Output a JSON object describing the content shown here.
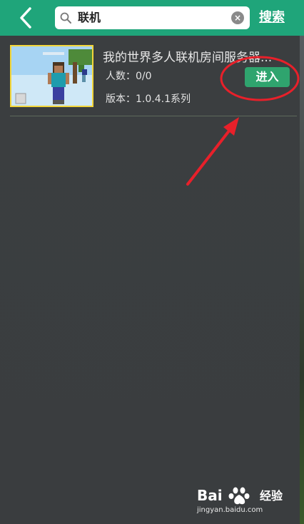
{
  "search": {
    "query": "联机",
    "button_label": "搜索",
    "clear_glyph": "×"
  },
  "result": {
    "title": "我的世界多人联机房间服务器...",
    "players_label": "人数：0/0",
    "version_label": "版本：1.0.4.1系列",
    "enter_label": "进入"
  },
  "watermark": {
    "brand": "Bai",
    "brand_suffix": "经验",
    "url": "jingyan.baidu.com"
  },
  "colors": {
    "header": "#1fa57a",
    "background": "#3c3f41",
    "enter_button": "#2fa46e",
    "annotation": "#e8202a",
    "thumb_border": "#f2d63a"
  },
  "icons": {
    "back": "chevron-left-icon",
    "search": "magnifier-icon",
    "clear": "clear-circle-icon",
    "paw": "baidu-paw-icon"
  }
}
